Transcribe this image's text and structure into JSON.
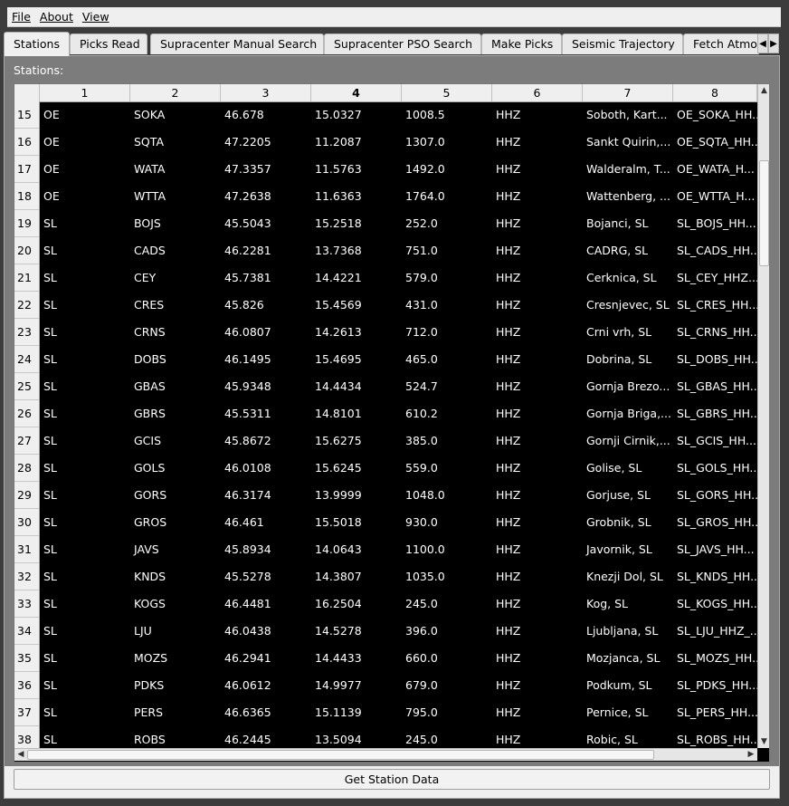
{
  "menu": {
    "items": [
      "File",
      "About",
      "View"
    ]
  },
  "tabs": [
    {
      "label": "Stations",
      "active": true
    },
    {
      "label": "Picks Read"
    },
    {
      "label": "Supracenter Manual Search"
    },
    {
      "label": "Supracenter PSO Search"
    },
    {
      "label": "Make Picks"
    },
    {
      "label": "Seismic Trajectory"
    },
    {
      "label": "Fetch Atmo"
    }
  ],
  "tab_scroll": {
    "left": "◀",
    "right": "▶"
  },
  "stations_label": "Stations:",
  "table": {
    "columns": [
      "1",
      "2",
      "3",
      "4",
      "5",
      "6",
      "7",
      "8"
    ],
    "sorted_column": "4",
    "rows": [
      {
        "n": "15",
        "c": [
          "OE",
          "SOKA",
          "46.678",
          "15.0327",
          "1008.5",
          "HHZ",
          "Soboth, Kart...",
          "OE_SOKA_HH..."
        ]
      },
      {
        "n": "16",
        "c": [
          "OE",
          "SQTA",
          "47.2205",
          "11.2087",
          "1307.0",
          "HHZ",
          "Sankt Quirin,...",
          "OE_SQTA_HH..."
        ]
      },
      {
        "n": "17",
        "c": [
          "OE",
          "WATA",
          "47.3357",
          "11.5763",
          "1492.0",
          "HHZ",
          "Walderalm, T...",
          "OE_WATA_H..."
        ]
      },
      {
        "n": "18",
        "c": [
          "OE",
          "WTTA",
          "47.2638",
          "11.6363",
          "1764.0",
          "HHZ",
          "Wattenberg, ...",
          "OE_WTTA_H..."
        ]
      },
      {
        "n": "19",
        "c": [
          "SL",
          "BOJS",
          "45.5043",
          "15.2518",
          "252.0",
          "HHZ",
          "Bojanci, SL",
          "SL_BOJS_HH..."
        ]
      },
      {
        "n": "20",
        "c": [
          "SL",
          "CADS",
          "46.2281",
          "13.7368",
          "751.0",
          "HHZ",
          "CADRG, SL",
          "SL_CADS_HH..."
        ]
      },
      {
        "n": "21",
        "c": [
          "SL",
          "CEY",
          "45.7381",
          "14.4221",
          "579.0",
          "HHZ",
          "Cerknica, SL",
          "SL_CEY_HHZ..."
        ]
      },
      {
        "n": "22",
        "c": [
          "SL",
          "CRES",
          "45.826",
          "15.4569",
          "431.0",
          "HHZ",
          "Cresnjevec, SL",
          "SL_CRES_HH..."
        ]
      },
      {
        "n": "23",
        "c": [
          "SL",
          "CRNS",
          "46.0807",
          "14.2613",
          "712.0",
          "HHZ",
          "Crni vrh, SL",
          "SL_CRNS_HH..."
        ]
      },
      {
        "n": "24",
        "c": [
          "SL",
          "DOBS",
          "46.1495",
          "15.4695",
          "465.0",
          "HHZ",
          "Dobrina, SL",
          "SL_DOBS_HH..."
        ]
      },
      {
        "n": "25",
        "c": [
          "SL",
          "GBAS",
          "45.9348",
          "14.4434",
          "524.7",
          "HHZ",
          "Gornja Brezo...",
          "SL_GBAS_HH..."
        ]
      },
      {
        "n": "26",
        "c": [
          "SL",
          "GBRS",
          "45.5311",
          "14.8101",
          "610.2",
          "HHZ",
          "Gornja Briga,...",
          "SL_GBRS_HH..."
        ]
      },
      {
        "n": "27",
        "c": [
          "SL",
          "GCIS",
          "45.8672",
          "15.6275",
          "385.0",
          "HHZ",
          "Gornji Cirnik,...",
          "SL_GCIS_HH..."
        ]
      },
      {
        "n": "28",
        "c": [
          "SL",
          "GOLS",
          "46.0108",
          "15.6245",
          "559.0",
          "HHZ",
          "Golise, SL",
          "SL_GOLS_HH..."
        ]
      },
      {
        "n": "29",
        "c": [
          "SL",
          "GORS",
          "46.3174",
          "13.9999",
          "1048.0",
          "HHZ",
          "Gorjuse, SL",
          "SL_GORS_HH..."
        ]
      },
      {
        "n": "30",
        "c": [
          "SL",
          "GROS",
          "46.461",
          "15.5018",
          "930.0",
          "HHZ",
          "Grobnik, SL",
          "SL_GROS_HH..."
        ]
      },
      {
        "n": "31",
        "c": [
          "SL",
          "JAVS",
          "45.8934",
          "14.0643",
          "1100.0",
          "HHZ",
          "Javornik, SL",
          "SL_JAVS_HH..."
        ]
      },
      {
        "n": "32",
        "c": [
          "SL",
          "KNDS",
          "45.5278",
          "14.3807",
          "1035.0",
          "HHZ",
          "Knezji Dol, SL",
          "SL_KNDS_HH..."
        ]
      },
      {
        "n": "33",
        "c": [
          "SL",
          "KOGS",
          "46.4481",
          "16.2504",
          "245.0",
          "HHZ",
          "Kog, SL",
          "SL_KOGS_HH..."
        ]
      },
      {
        "n": "34",
        "c": [
          "SL",
          "LJU",
          "46.0438",
          "14.5278",
          "396.0",
          "HHZ",
          "Ljubljana, SL",
          "SL_LJU_HHZ_..."
        ]
      },
      {
        "n": "35",
        "c": [
          "SL",
          "MOZS",
          "46.2941",
          "14.4433",
          "660.0",
          "HHZ",
          "Mozjanca, SL",
          "SL_MOZS_HH..."
        ]
      },
      {
        "n": "36",
        "c": [
          "SL",
          "PDKS",
          "46.0612",
          "14.9977",
          "679.0",
          "HHZ",
          "Podkum, SL",
          "SL_PDKS_HH..."
        ]
      },
      {
        "n": "37",
        "c": [
          "SL",
          "PERS",
          "46.6365",
          "15.1139",
          "795.0",
          "HHZ",
          "Pernice, SL",
          "SL_PERS_HH..."
        ]
      },
      {
        "n": "38",
        "c": [
          "SL",
          "ROBS",
          "46.2445",
          "13.5094",
          "245.0",
          "HHZ",
          "Robic, SL",
          "SL_ROBS_HH..."
        ]
      }
    ]
  },
  "scroll": {
    "up": "▲",
    "down": "▼",
    "left": "◀",
    "right": "▶"
  },
  "button": {
    "label": "Get Station Data"
  }
}
